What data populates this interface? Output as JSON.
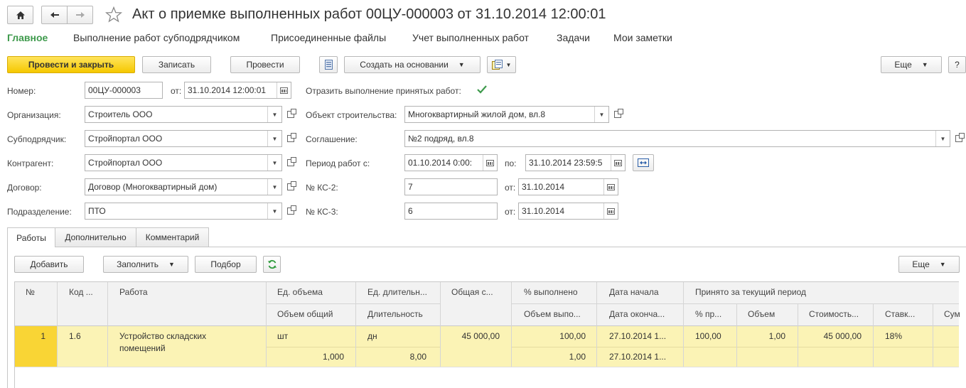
{
  "window": {
    "title": "Акт о приемке выполненных работ 00ЦУ-000003 от 31.10.2014 12:00:01"
  },
  "nav_menu": {
    "items": [
      "Главное",
      "Выполнение работ субподрядчиком",
      "Присоединенные файлы",
      "Учет выполненных работ",
      "Задачи",
      "Мои заметки"
    ]
  },
  "toolbar": {
    "post_close": "Провести и закрыть",
    "save": "Записать",
    "post": "Провести",
    "create_based": "Создать на основании",
    "more": "Еще",
    "help": "?"
  },
  "form": {
    "number_label": "Номер:",
    "number_value": "00ЦУ-000003",
    "date_from_label": "от:",
    "date_value": "31.10.2014 12:00:01",
    "reflect_label": "Отразить выполнение принятых работ:",
    "org_label": "Организация:",
    "org_value": "Строитель ООО",
    "sub_label": "Субподрядчик:",
    "sub_value": "Стройпортал ООО",
    "contr_label": "Контрагент:",
    "contr_value": "Стройпортал ООО",
    "contract_label": "Договор:",
    "contract_value": "Договор (Многоквартирный дом)",
    "dept_label": "Подразделение:",
    "dept_value": "ПТО",
    "object_label": "Объект строительства:",
    "object_value": "Многоквартирный жилой дом, вл.8",
    "agreement_label": "Соглашение:",
    "agreement_value": "№2 подряд, вл.8",
    "period_label": "Период работ с:",
    "period_from": "01.10.2014  0:00:",
    "period_to_label": "по:",
    "period_to": "31.10.2014 23:59:5",
    "ks2_label": "№ КС-2:",
    "ks2_value": "7",
    "ks2_date_label": "от:",
    "ks2_date": "31.10.2014",
    "ks3_label": "№ КС-3:",
    "ks3_value": "6",
    "ks3_date_label": "от:",
    "ks3_date": "31.10.2014"
  },
  "tabs": [
    "Работы",
    "Дополнительно",
    "Комментарий"
  ],
  "table_toolbar": {
    "add": "Добавить",
    "fill": "Заполнить",
    "pick": "Подбор",
    "more": "Еще"
  },
  "table": {
    "headers": {
      "num": "№",
      "code": "Код ...",
      "work": "Работа",
      "unit_vol": "Ед. объема",
      "unit_dur": "Ед. длительн...",
      "total_cost": "Общая с...",
      "pct_done": "% выполнено",
      "date_start": "Дата начала",
      "accepted_group": "Принято за текущий период",
      "vol_total": "Объем общий",
      "duration": "Длительность",
      "vol_done": "Объем выпо...",
      "date_end": "Дата оконча...",
      "pct_acc": "% пр...",
      "vol": "Объем",
      "cost": "Стоимость...",
      "rate": "Ставк...",
      "sum": "Сум"
    },
    "rows": [
      {
        "num": "1",
        "code": "1.6",
        "work_line1": "Устройство складских",
        "work_line2": "помещений",
        "unit_vol": "шт",
        "vol_total": "1,000",
        "unit_dur": "дн",
        "duration": "8,00",
        "total_cost": "45 000,00",
        "pct_done": "100,00",
        "vol_done": "1,00",
        "date_start": "27.10.2014 1...",
        "date_end": "27.10.2014 1...",
        "pct_acc": "100,00",
        "vol": "1,00",
        "cost": "45 000,00",
        "rate": "18%"
      }
    ]
  },
  "colors": {
    "accent_green": "#3e9a4c",
    "primary_button": "#f5c800",
    "row_highlight": "#fbf3b5",
    "row_num_highlight": "#f9d535"
  }
}
